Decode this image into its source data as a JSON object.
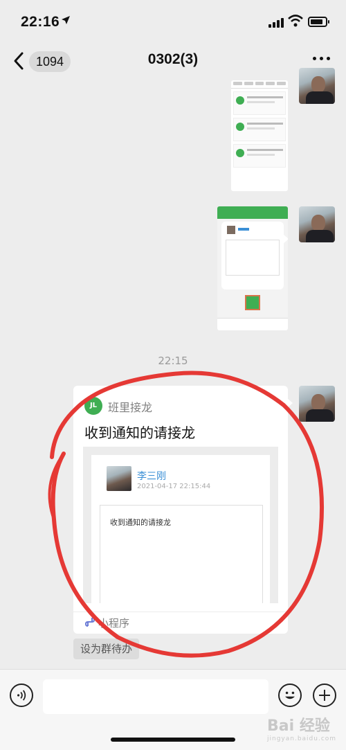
{
  "status_bar": {
    "time": "22:16"
  },
  "nav": {
    "back_count": "1094",
    "title": "0302(3)"
  },
  "chat": {
    "timestamp": "22:15",
    "mini_program_card": {
      "app_name": "班里接龙",
      "logo_text": "JL",
      "message": "收到通知的请接龙",
      "preview": {
        "author": "李三刚",
        "datetime": "2021-04-17 22:15:44",
        "body": "收到通知的请接龙"
      },
      "footer_label": "小程序"
    },
    "set_button_label": "设为群待办"
  },
  "watermark": {
    "brand": "Bai 经验",
    "domain": "jingyan.baidu.com"
  },
  "colors": {
    "background": "#ededed",
    "wechat_green": "#3fae53",
    "annotation_red": "#e53935",
    "link_blue": "#3a8fd6"
  }
}
